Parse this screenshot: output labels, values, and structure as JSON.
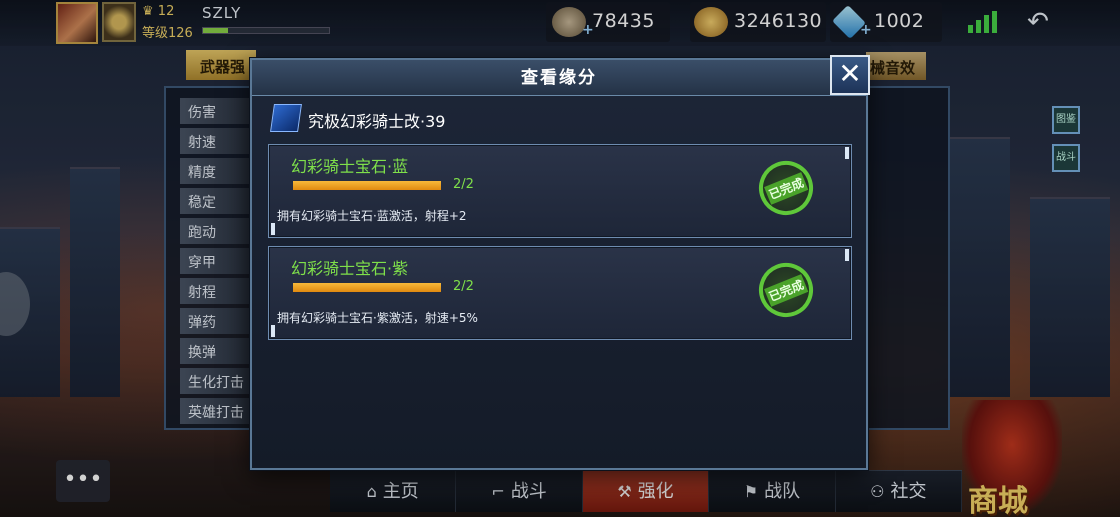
{
  "topbar": {
    "level_value": "12",
    "level_label": "等级126",
    "player_name": "SZLY",
    "exp_progress": 0.2,
    "resources": [
      {
        "name": "honor",
        "icon": "badge-icon",
        "value": "78435"
      },
      {
        "name": "gold",
        "icon": "gold-coin-icon",
        "value": "3246130"
      },
      {
        "name": "diamond",
        "icon": "diamond-icon",
        "value": "1002"
      }
    ],
    "signal_icon": "signal-icon",
    "back_icon": "back-arrow-icon"
  },
  "background": {
    "left_tab": "武器强",
    "right_tab": "械音效",
    "stats": [
      "伤害",
      "射速",
      "精度",
      "稳定",
      "跑动",
      "穿甲",
      "射程",
      "弹药",
      "换弹",
      "生化打击",
      "英雄打击"
    ],
    "side_buttons": [
      "图鉴",
      "战斗"
    ],
    "shop_label": "商城",
    "chat_icon": "chat-icon"
  },
  "dialog": {
    "title": "查看缘分",
    "close_label": "✕",
    "weapon_name": "究极幻彩骑士改·39",
    "cards": [
      {
        "title": "幻彩骑士宝石·蓝",
        "progress_text": "2/2",
        "progress": 1.0,
        "description": "拥有幻彩骑士宝石·蓝激活，射程+2",
        "stamp": "已完成"
      },
      {
        "title": "幻彩骑士宝石·紫",
        "progress_text": "2/2",
        "progress": 1.0,
        "description": "拥有幻彩骑士宝石·紫激活，射速+5%",
        "stamp": "已完成"
      }
    ]
  },
  "bottom_nav": [
    {
      "label": "主页",
      "icon": "home-icon",
      "active": false
    },
    {
      "label": "战斗",
      "icon": "gun-icon",
      "active": false
    },
    {
      "label": "强化",
      "icon": "hammer-icon",
      "active": true
    },
    {
      "label": "战队",
      "icon": "flag-icon",
      "active": false
    },
    {
      "label": "社交",
      "icon": "people-icon",
      "active": false
    }
  ],
  "colors": {
    "accent_green": "#7fe04a",
    "progress_orange": "#f0a020",
    "active_nav": "#b8402a",
    "dialog_border": "#5a7896"
  }
}
